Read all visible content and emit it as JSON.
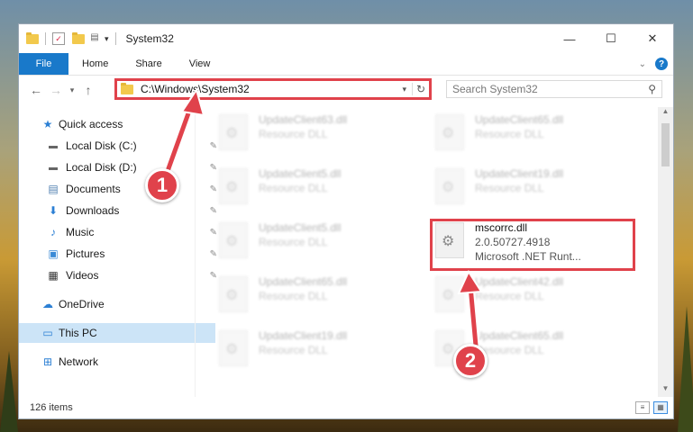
{
  "window": {
    "title": "System32",
    "controls": {
      "minimize": "—",
      "maximize": "☐",
      "close": "✕"
    }
  },
  "ribbon": {
    "tabs": [
      "File",
      "Home",
      "Share",
      "View"
    ],
    "help": "?"
  },
  "address": {
    "path": "C:\\Windows\\System32",
    "search_placeholder": "Search System32"
  },
  "nav": {
    "items": [
      {
        "label": "Quick access",
        "icon": "star-icon"
      },
      {
        "label": "Local Disk (C:)",
        "icon": "drive-icon",
        "pinned": true
      },
      {
        "label": "Local Disk (D:)",
        "icon": "drive-icon",
        "pinned": true
      },
      {
        "label": "Documents",
        "icon": "documents-icon",
        "pinned": true
      },
      {
        "label": "Downloads",
        "icon": "download-icon",
        "pinned": true
      },
      {
        "label": "Music",
        "icon": "music-icon",
        "pinned": true
      },
      {
        "label": "Pictures",
        "icon": "pictures-icon",
        "pinned": true
      },
      {
        "label": "Videos",
        "icon": "videos-icon",
        "pinned": true
      },
      {
        "label": "OneDrive",
        "icon": "cloud-icon"
      },
      {
        "label": "This PC",
        "icon": "computer-icon",
        "selected": true
      },
      {
        "label": "Network",
        "icon": "network-icon"
      }
    ]
  },
  "files": [
    {
      "name": "UpdateClient63.dll",
      "sub": "Resource DLL"
    },
    {
      "name": "UpdateClient65.dll",
      "sub": "Resource DLL"
    },
    {
      "name": "UpdateClient5.dll",
      "sub": "Resource DLL"
    },
    {
      "name": "UpdateClient19.dll",
      "sub": "Resource DLL"
    },
    {
      "name": "UpdateClient5.dll",
      "sub": "Resource DLL"
    },
    {
      "name": "mscorrc.dll",
      "version": "2.0.50727.4918",
      "sub": "Microsoft .NET Runt..."
    },
    {
      "name": "UpdateClient65.dll",
      "sub": "Resource DLL"
    },
    {
      "name": "UpdateClient42.dll",
      "sub": "Resource DLL"
    },
    {
      "name": "UpdateClient19.dll",
      "sub": "Resource DLL"
    },
    {
      "name": "UpdateClient65.dll",
      "sub": "Resource DLL"
    }
  ],
  "status": {
    "count": "126 items"
  },
  "annotations": {
    "step1": "1",
    "step2": "2",
    "color": "#e0424b"
  }
}
